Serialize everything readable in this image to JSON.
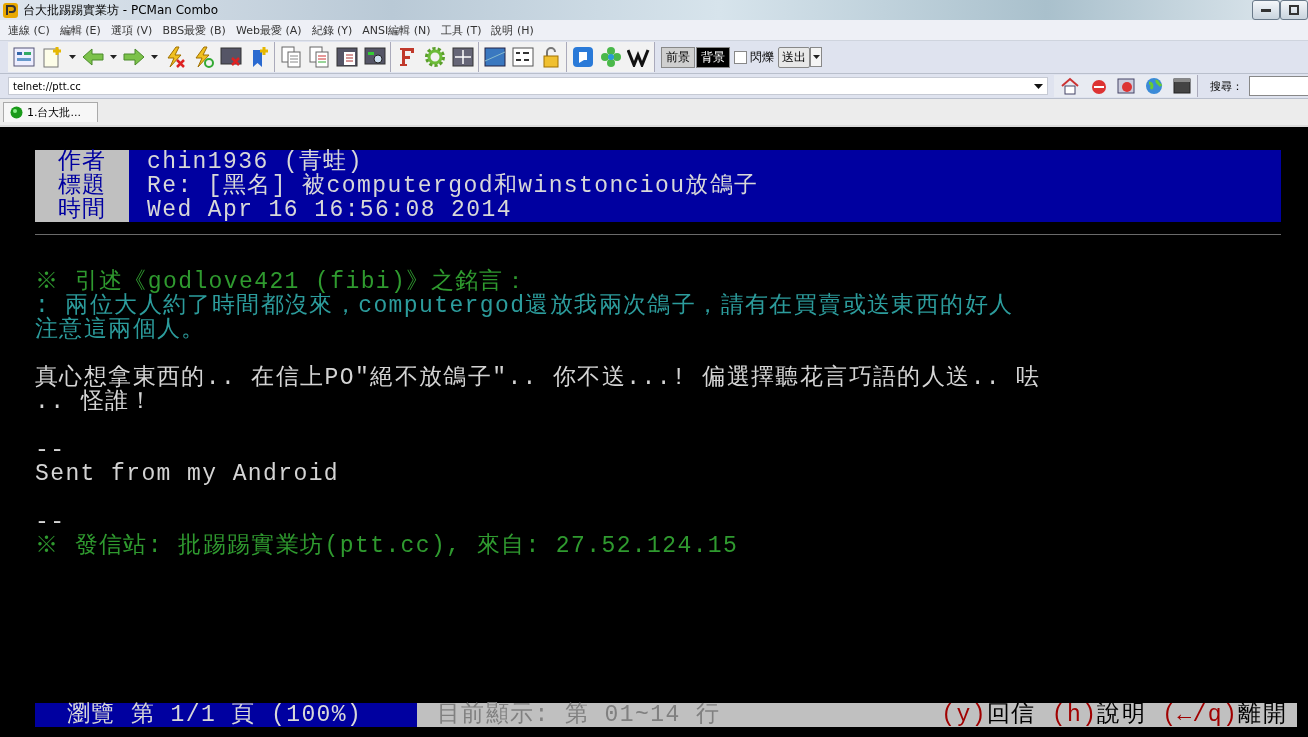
{
  "window": {
    "title": "台大批踢踢實業坊 - PCMan Combo"
  },
  "menu": [
    "連線 (C)",
    "編輯 (E)",
    "選項 (V)",
    "BBS最愛 (B)",
    "Web最愛 (A)",
    "紀錄 (Y)",
    "ANSI編輯 (N)",
    "工具 (T)",
    "說明 (H)"
  ],
  "toolbar": {
    "fg_button": "前景",
    "bg_button": {
      "label": "背景",
      "selected": true
    },
    "blink": {
      "label": "閃爍",
      "checked": false
    },
    "send_button": "送出"
  },
  "address": {
    "value": "telnet://ptt.cc"
  },
  "search": {
    "label": "搜尋："
  },
  "tabs": [
    {
      "label": "1.台大批...",
      "selected": true
    }
  ],
  "article": {
    "header": [
      {
        "label": "作者",
        "value": "chin1936 (青蛙)"
      },
      {
        "label": "標題",
        "value": "Re: [黑名] 被computergod和winstonciou放鴿子"
      },
      {
        "label": "時間",
        "value": "Wed Apr 16 16:56:08 2014"
      }
    ],
    "lines": [
      {
        "kind": "blank"
      },
      {
        "kind": "quote-header",
        "text": "※ 引述《godlove421 (fibi)》之銘言："
      },
      {
        "kind": "quote",
        "text": ": 兩位大人約了時間都沒來，computergod還放我兩次鴿子，請有在買賣或送東西的好人"
      },
      {
        "kind": "quote",
        "text": "注意這兩個人。"
      },
      {
        "kind": "blank"
      },
      {
        "kind": "body",
        "text": "真心想拿東西的.. 在信上PO\"絕不放鴿子\".. 你不送...! 偏選擇聽花言巧語的人送.. 呿"
      },
      {
        "kind": "body",
        "text": ".. 怪誰！"
      },
      {
        "kind": "blank"
      },
      {
        "kind": "body",
        "text": "--"
      },
      {
        "kind": "body",
        "text": "Sent from my Android"
      },
      {
        "kind": "blank"
      },
      {
        "kind": "body",
        "text": "--"
      },
      {
        "kind": "origin",
        "text": "※ 發信站: 批踢踢實業坊(ptt.cc), 來自: 27.52.124.15"
      }
    ]
  },
  "status": {
    "page": "瀏覽 第 1/1 頁 (100%)",
    "range": "目前顯示: 第 01~14 行",
    "commands": [
      {
        "key": "(y)",
        "label": "回信"
      },
      {
        "key": "(h)",
        "label": "說明"
      },
      {
        "key": "(←/q)",
        "label": "離開"
      }
    ]
  }
}
